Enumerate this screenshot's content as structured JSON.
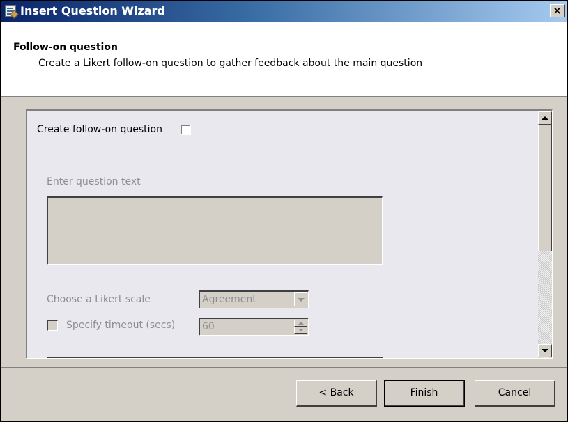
{
  "window": {
    "title": "Insert Question Wizard",
    "close_label": "×"
  },
  "header": {
    "title": "Follow-on question",
    "subtitle": "Create a Likert follow-on question to gather feedback about the main question"
  },
  "form": {
    "create_followon_label": "Create follow-on question",
    "create_followon_checked": false,
    "question_text_label": "Enter question text",
    "question_text_value": "",
    "likert_label": "Choose a Likert scale",
    "likert_value": "Agreement",
    "timeout_label": "Specify timeout (secs)",
    "timeout_checked": false,
    "timeout_value": "60"
  },
  "buttons": {
    "back": "< Back",
    "finish": "Finish",
    "cancel": "Cancel"
  },
  "icons": {
    "app_icon": "wizard-app-icon",
    "close": "close-icon",
    "scroll_up": "scroll-up-arrow-icon",
    "scroll_down": "scroll-down-arrow-icon",
    "dropdown": "chevron-down-icon",
    "spin_up": "spin-up-icon",
    "spin_down": "spin-down-icon"
  },
  "colors": {
    "titlebar_start": "#0a246a",
    "titlebar_end": "#a6caf0",
    "disabled_text": "#8f8f8f",
    "dialog_face": "#d4d0c8"
  }
}
